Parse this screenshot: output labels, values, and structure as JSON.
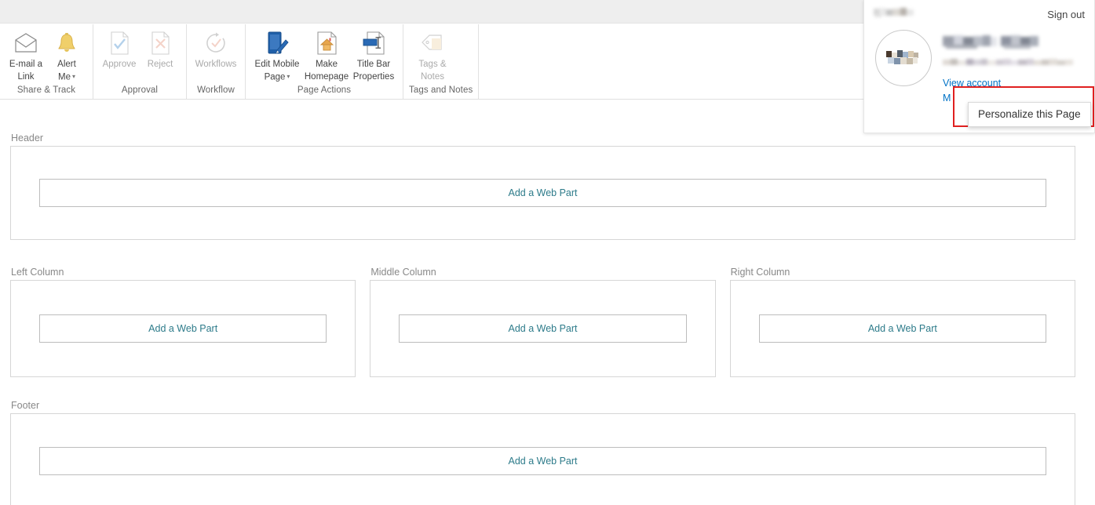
{
  "suite_bar": {
    "background": "#eeeeee"
  },
  "ribbon": {
    "groups": [
      {
        "label": "Share & Track",
        "buttons": [
          {
            "label_line1": "E-mail a",
            "label_line2": "Link",
            "icon": "email-envelope-icon",
            "disabled": false,
            "has_caret": false
          },
          {
            "label_line1": "Alert",
            "label_line2": "Me",
            "icon": "bell-alert-icon",
            "disabled": false,
            "has_caret": true
          }
        ]
      },
      {
        "label": "Approval",
        "buttons": [
          {
            "label_line1": "Approve",
            "label_line2": "",
            "icon": "approve-checkmark-icon",
            "disabled": true,
            "has_caret": false
          },
          {
            "label_line1": "Reject",
            "label_line2": "",
            "icon": "reject-cross-icon",
            "disabled": true,
            "has_caret": false
          }
        ]
      },
      {
        "label": "Workflow",
        "buttons": [
          {
            "label_line1": "Workflows",
            "label_line2": "",
            "icon": "workflow-circle-arrow-icon",
            "disabled": true,
            "has_caret": false
          }
        ]
      },
      {
        "label": "Page Actions",
        "buttons": [
          {
            "label_line1": "Edit Mobile",
            "label_line2": "Page",
            "icon": "edit-mobile-page-icon",
            "disabled": false,
            "has_caret": true
          },
          {
            "label_line1": "Make",
            "label_line2": "Homepage",
            "icon": "make-homepage-icon",
            "disabled": false,
            "has_caret": false
          },
          {
            "label_line1": "Title Bar",
            "label_line2": "Properties",
            "icon": "title-bar-properties-icon",
            "disabled": false,
            "has_caret": false
          }
        ]
      },
      {
        "label": "Tags and Notes",
        "buttons": [
          {
            "label_line1": "Tags &",
            "label_line2": "Notes",
            "icon": "tag-notes-icon",
            "disabled": true,
            "has_caret": false
          }
        ]
      }
    ]
  },
  "canvas": {
    "add_web_part_label": "Add a Web Part",
    "header_zone": {
      "label": "Header"
    },
    "columns": [
      {
        "label": "Left Column"
      },
      {
        "label": "Middle Column"
      },
      {
        "label": "Right Column"
      }
    ],
    "footer_zone": {
      "label": "Footer"
    }
  },
  "account_panel": {
    "tenant_name_redacted": true,
    "sign_out_label": "Sign out",
    "user_name_redacted": true,
    "user_email_redacted": true,
    "view_account_label": "View account",
    "second_link_visible_text": "M",
    "ellipsis_label": "···",
    "link_color": "#0072c6"
  },
  "context_menu": {
    "items": [
      "Personalize this Page"
    ]
  },
  "highlight": {
    "color": "#e02020"
  }
}
